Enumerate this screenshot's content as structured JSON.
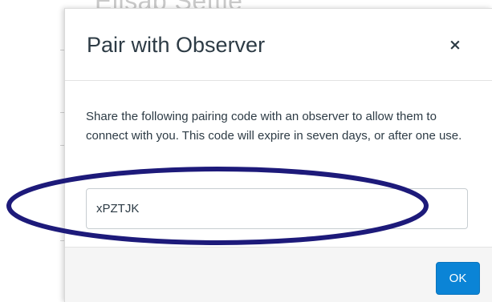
{
  "background": {
    "partial_title": "Elisab  Settle"
  },
  "dialog": {
    "title": "Pair with Observer",
    "close_label": "×",
    "description": "Share the following pairing code with an observer to allow them to connect with you. This code will expire in seven days, or after one use.",
    "pairing_code": "xPZTJK",
    "ok_label": "OK"
  },
  "colors": {
    "primary_button": "#0b84d6",
    "annotation_ellipse": "#1d1a7a",
    "text": "#2d3b45"
  },
  "icons": {
    "close": "close-icon"
  }
}
